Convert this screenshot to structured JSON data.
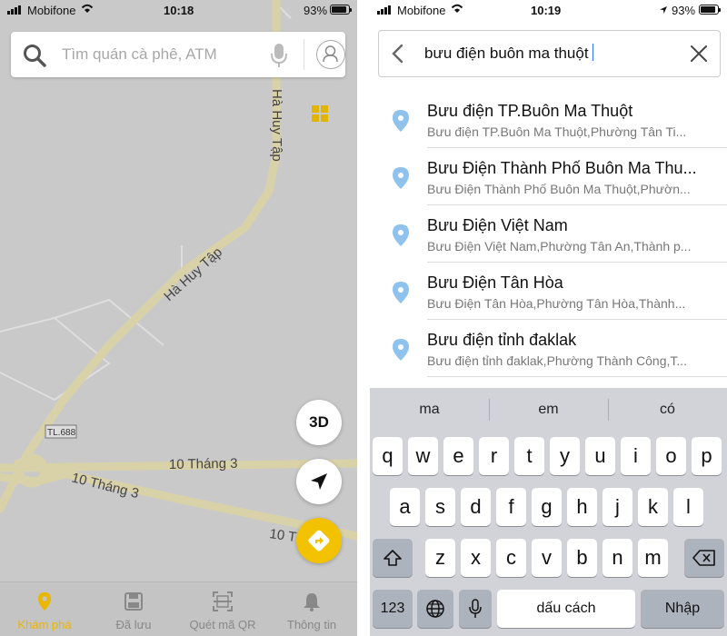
{
  "left": {
    "status": {
      "carrier": "Mobifone",
      "time": "10:18",
      "battery": "93%"
    },
    "search": {
      "placeholder": "Tìm quán cà phê, ATM",
      "search_icon": "search-icon",
      "mic_icon": "microphone-icon",
      "profile_icon": "profile-icon"
    },
    "map": {
      "roads": {
        "ha_huy_tap_1": "Hà Huy Tập",
        "ha_huy_tap_2": "Hà Huy Tập",
        "road_10_thang_3_a": "10 Tháng 3",
        "road_10_thang_3_b": "10 Tháng 3",
        "road_10_t": "10 T",
        "tl_sign": "TL.688"
      },
      "colors": {
        "background": "#c9c9c9",
        "road": "#d9d2a8",
        "accent": "#f2c200"
      }
    },
    "buttons": {
      "layers_icon": "grid-icon",
      "three_d": "3D",
      "nav_icon": "navigation-arrow-icon",
      "dir_icon": "directions-icon"
    },
    "tabs": [
      {
        "label": "Khám phá",
        "icon": "map-pin-icon",
        "active": true
      },
      {
        "label": "Đã lưu",
        "icon": "save-icon",
        "active": false
      },
      {
        "label": "Quét mã QR",
        "icon": "qr-scan-icon",
        "active": false
      },
      {
        "label": "Thông tin",
        "icon": "bell-icon",
        "active": false
      }
    ]
  },
  "right": {
    "status": {
      "carrier": "Mobifone",
      "time": "10:19",
      "battery": "93%"
    },
    "search": {
      "value": "bưu điện buôn ma thuột",
      "back_icon": "chevron-left-icon",
      "clear_icon": "close-icon"
    },
    "results": [
      {
        "title": "Bưu điện TP.Buôn Ma Thuột",
        "subtitle": "Bưu điện TP.Buôn Ma Thuột,Phường Tân Ti..."
      },
      {
        "title": "Bưu Điện Thành Phố Buôn Ma Thu...",
        "subtitle": "Bưu Điện Thành Phố Buôn Ma Thuột,Phườn..."
      },
      {
        "title": "Bưu Điện Việt Nam",
        "subtitle": "Bưu Điện Việt Nam,Phường Tân An,Thành p..."
      },
      {
        "title": "Bưu Điện Tân Hòa",
        "subtitle": "Bưu Điện Tân Hòa,Phường Tân Hòa,Thành..."
      },
      {
        "title": "Bưu điện tỉnh đaklak",
        "subtitle": "Bưu điện tỉnh đaklak,Phường Thành Công,T..."
      }
    ],
    "keyboard": {
      "suggestions": [
        "ma",
        "em",
        "có"
      ],
      "row1": [
        "q",
        "w",
        "e",
        "r",
        "t",
        "y",
        "u",
        "i",
        "o",
        "p"
      ],
      "row2": [
        "a",
        "s",
        "d",
        "f",
        "g",
        "h",
        "j",
        "k",
        "l"
      ],
      "row3": [
        "z",
        "x",
        "c",
        "v",
        "b",
        "n",
        "m"
      ],
      "numbers": "123",
      "space": "dấu cách",
      "enter": "Nhập"
    }
  }
}
